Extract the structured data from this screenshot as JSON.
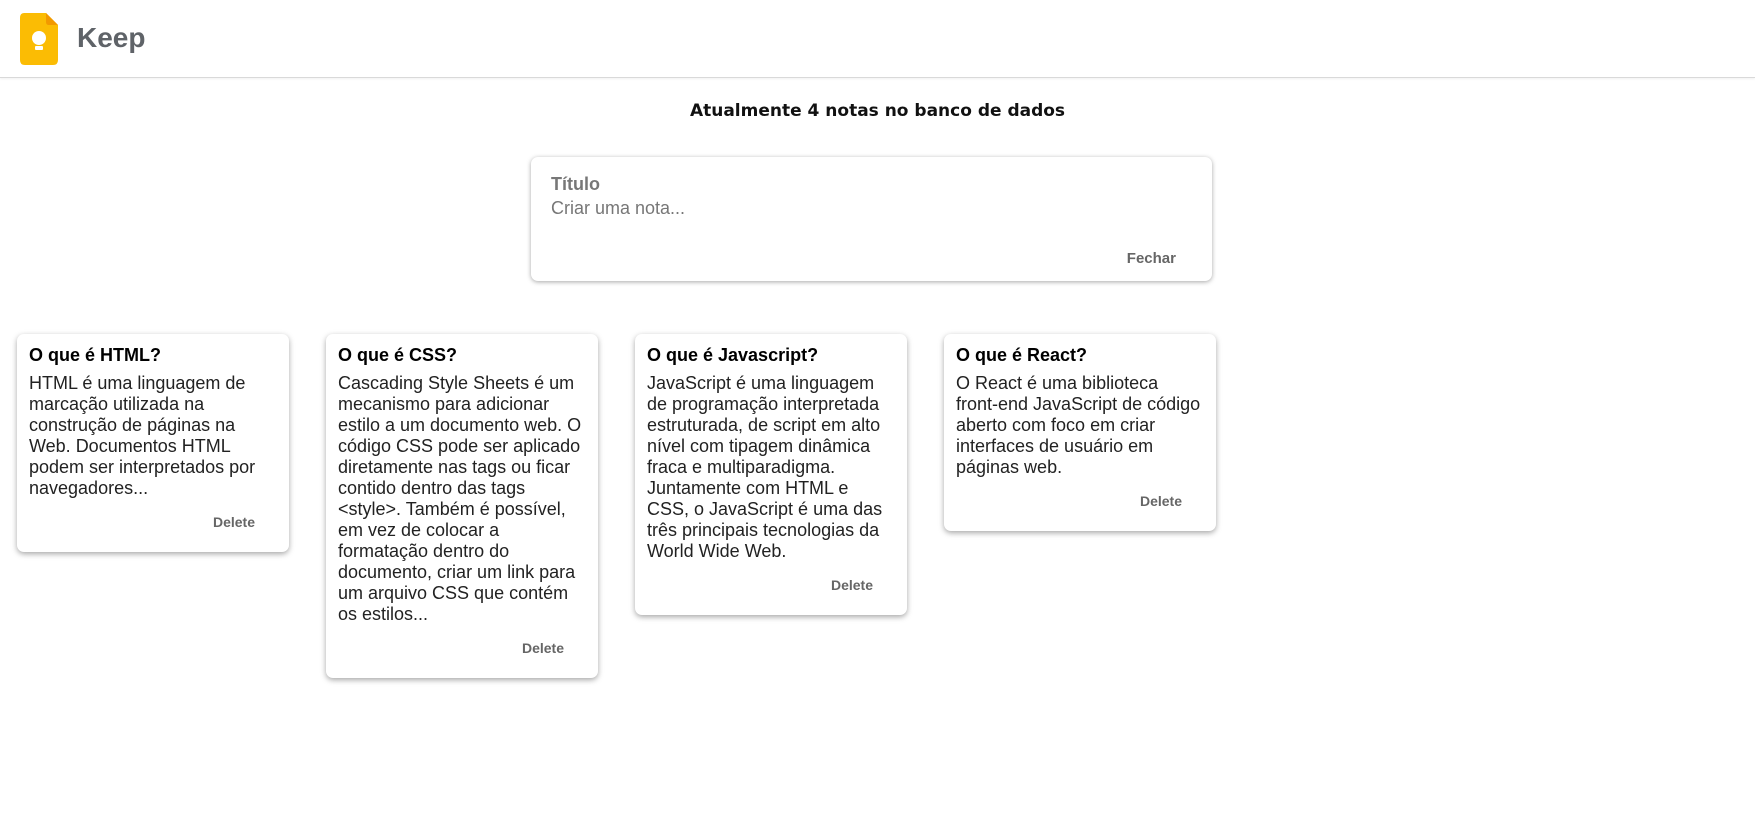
{
  "header": {
    "app_title": "Keep",
    "logo_icon": "keep-lightbulb-icon",
    "logo_color": "#FBBC04"
  },
  "summary": {
    "note_count_text": "Atualmente 4 notas no banco de dados"
  },
  "create_form": {
    "title_placeholder": "Título",
    "title_value": "",
    "content_placeholder": "Criar uma nota...",
    "content_value": "",
    "close_label": "Fechar"
  },
  "notes": [
    {
      "title": "O que é HTML?",
      "content": "HTML é uma linguagem de marcação utilizada na construção de páginas na Web. Documentos HTML podem ser interpretados por navegadores...",
      "delete_label": "Delete"
    },
    {
      "title": "O que é CSS?",
      "content": "Cascading Style Sheets é um mecanismo para adicionar estilo a um documento web. O código CSS pode ser aplicado diretamente nas tags ou ficar contido dentro das tags <style>. Também é possível, em vez de colocar a formatação dentro do documento, criar um link para um arquivo CSS que contém os estilos...",
      "delete_label": "Delete"
    },
    {
      "title": "O que é Javascript?",
      "content": "JavaScript é uma linguagem de programação interpretada estruturada, de script em alto nível com tipagem dinâmica fraca e multiparadigma. Juntamente com HTML e CSS, o JavaScript é uma das três principais tecnologias da World Wide Web.",
      "delete_label": "Delete"
    },
    {
      "title": "O que é React?",
      "content": "O React é uma biblioteca front-end JavaScript de código aberto com foco em criar interfaces de usuário em páginas web.",
      "delete_label": "Delete"
    }
  ]
}
